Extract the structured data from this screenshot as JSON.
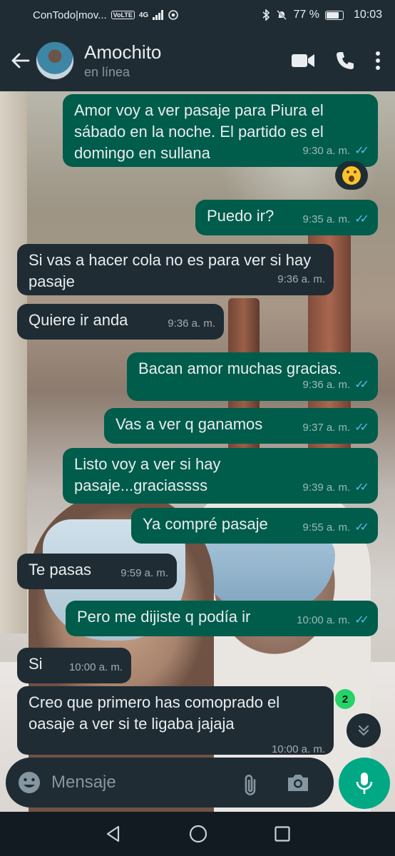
{
  "status_bar": {
    "carrier": "ConTodo|mov...",
    "volte": "VoLTE",
    "network": "4G",
    "battery": "77 %",
    "time": "10:03"
  },
  "header": {
    "contact_name": "Amochito",
    "contact_status": "en línea"
  },
  "messages": [
    {
      "dir": "out",
      "text": "Amor voy a ver pasaje para Piura el sábado en la noche. El partido es el domingo en sullana",
      "time": "9:30 a. m.",
      "read": true
    },
    {
      "dir": "out",
      "text": "Puedo ir?",
      "time": "9:35 a. m.",
      "read": true
    },
    {
      "dir": "in",
      "text": "Si vas a hacer cola no es para  ver si hay pasaje",
      "time": "9:36 a. m."
    },
    {
      "dir": "in",
      "text": "Quiere ir anda",
      "time": "9:36 a. m."
    },
    {
      "dir": "out",
      "text": "Bacan amor muchas gracias.",
      "time": "9:36 a. m.",
      "read": true
    },
    {
      "dir": "out",
      "text": "Vas a ver q ganamos",
      "time": "9:37 a. m.",
      "read": true
    },
    {
      "dir": "out",
      "text": "Listo voy a ver si hay pasaje...graciassss",
      "time": "9:39 a. m.",
      "read": true
    },
    {
      "dir": "out",
      "text": "Ya compré pasaje",
      "time": "9:55 a. m.",
      "read": true
    },
    {
      "dir": "in",
      "text": "Te pasas",
      "time": "9:59 a. m."
    },
    {
      "dir": "out",
      "text": "Pero me dijiste q podía ir",
      "time": "10:00 a. m.",
      "read": true
    },
    {
      "dir": "in",
      "text": "Si",
      "time": "10:00 a. m."
    },
    {
      "dir": "in",
      "text": "Creo que primero has comoprado el oasaje a ver si te ligaba jajaja",
      "time": "10:00 a. m."
    }
  ],
  "unread_count": "2",
  "input": {
    "placeholder": "Mensaje"
  },
  "colors": {
    "outgoing_bubble": "#005c4b",
    "incoming_bubble": "#1f2c34",
    "accent": "#00a884",
    "read_ticks": "#53bdeb"
  },
  "icons": [
    "back-arrow-icon",
    "video-call-icon",
    "phone-icon",
    "more-vert-icon",
    "emoji-icon",
    "attach-icon",
    "camera-icon",
    "mic-icon",
    "chevron-down-icon",
    "nav-back-icon",
    "nav-home-icon",
    "nav-recents-icon"
  ]
}
